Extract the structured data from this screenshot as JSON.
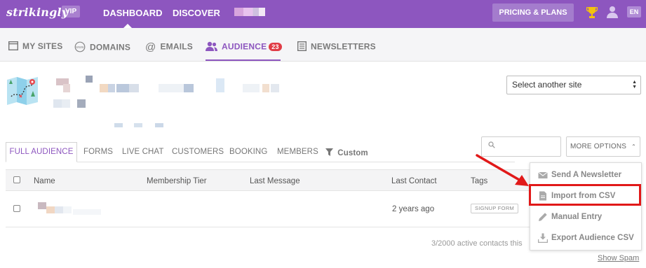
{
  "topbar": {
    "logo": "strikingly",
    "vip": "VIP",
    "nav": [
      "DASHBOARD",
      "DISCOVER"
    ],
    "pricing_label": "PRICING & PLANS",
    "lang": "EN",
    "icons": [
      "trophy-icon",
      "user-icon"
    ]
  },
  "subnav": {
    "items": [
      {
        "label": "MY SITES",
        "icon": "browser-window-icon"
      },
      {
        "label": "DOMAINS",
        "icon": "www-globe-icon"
      },
      {
        "label": "EMAILS",
        "icon": "at-sign-icon"
      },
      {
        "label": "AUDIENCE",
        "icon": "people-icon",
        "badge": "23",
        "active": true
      },
      {
        "label": "NEWSLETTERS",
        "icon": "newsletter-icon"
      }
    ]
  },
  "site": {
    "select_label": "Select another site"
  },
  "audience_tabs": {
    "items": [
      "FULL AUDIENCE",
      "FORMS",
      "LIVE CHAT",
      "CUSTOMERS",
      "BOOKING",
      "MEMBERS"
    ],
    "custom_label": "Custom",
    "more_options": "MORE OPTIONS"
  },
  "table": {
    "columns": [
      "Name",
      "Membership Tier",
      "Last Message",
      "Last Contact",
      "Tags"
    ],
    "rows": [
      {
        "name": "",
        "tier": "",
        "last_message": "",
        "last_contact": "2 years ago",
        "tag": "SIGNUP FORM"
      }
    ]
  },
  "footer": {
    "count_text": "3/2000 active contacts this",
    "show_spam": "Show Spam"
  },
  "dropdown": {
    "items": [
      {
        "label": "Send A Newsletter",
        "icon": "envelope-icon"
      },
      {
        "label": "Import from CSV",
        "icon": "document-icon",
        "highlighted": true
      },
      {
        "label": "Manual Entry",
        "icon": "pencil-icon"
      },
      {
        "label": "Export Audience CSV",
        "icon": "download-icon"
      }
    ]
  },
  "colors": {
    "brand": "#8d56bf",
    "badge": "#e03c46",
    "annotation": "#e11919"
  }
}
